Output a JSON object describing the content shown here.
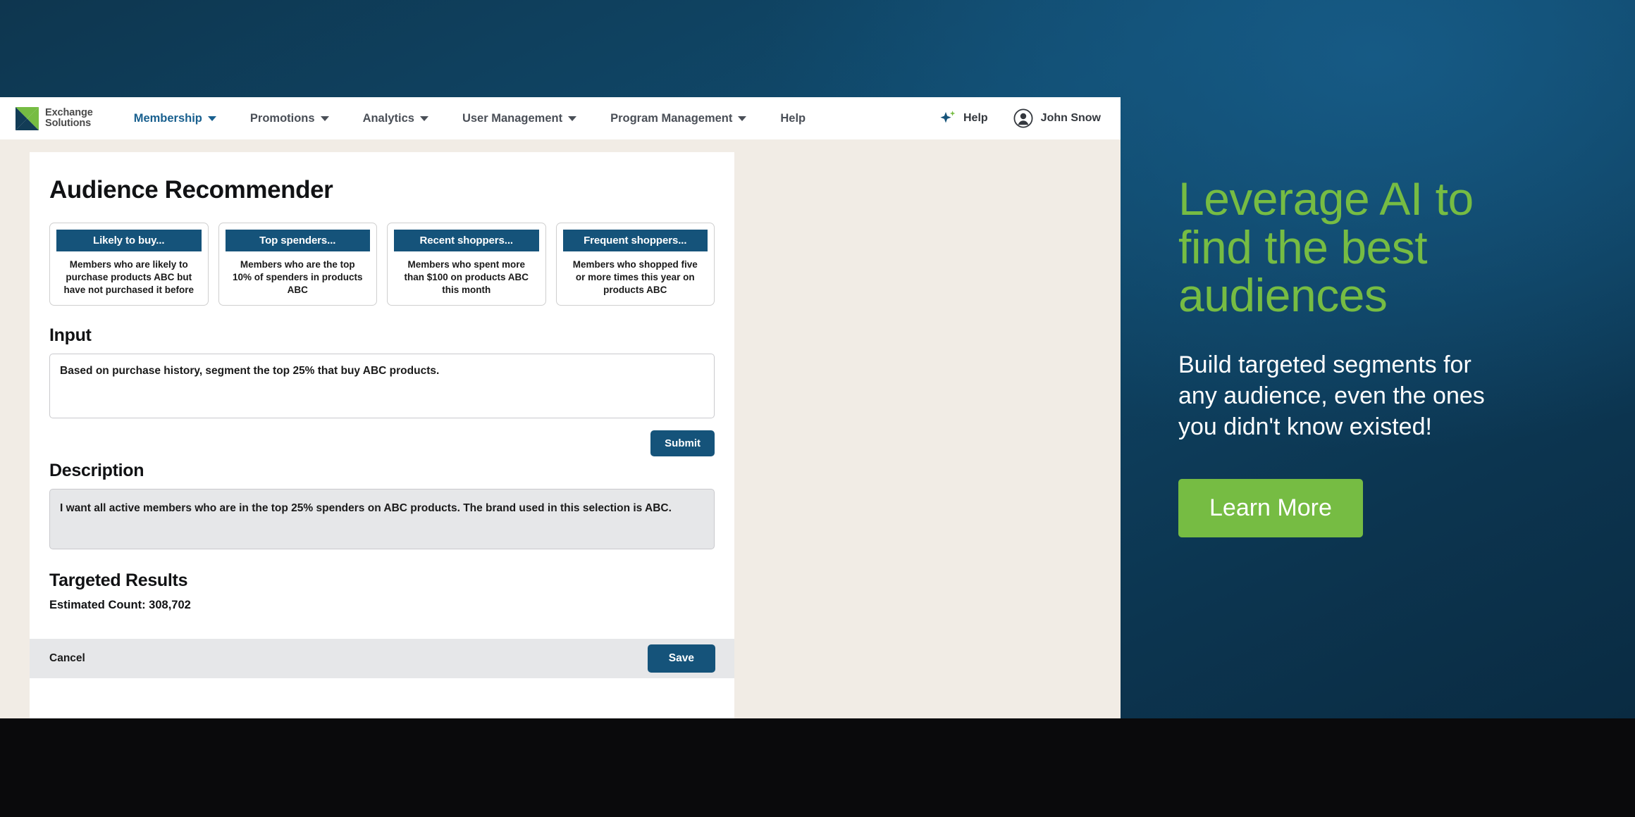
{
  "brand": {
    "logo_text": "Exchange\nSolutions",
    "logo_icon": "exchange-solutions-x-logo",
    "green": "#76bc43",
    "navy": "#15537a"
  },
  "navbar": {
    "items": [
      {
        "label": "Membership",
        "has_caret": true,
        "active": true
      },
      {
        "label": "Promotions",
        "has_caret": true,
        "active": false
      },
      {
        "label": "Analytics",
        "has_caret": true,
        "active": false
      },
      {
        "label": "User Management",
        "has_caret": true,
        "active": false
      },
      {
        "label": "Program Management",
        "has_caret": true,
        "active": false
      },
      {
        "label": "Help",
        "has_caret": false,
        "active": false
      }
    ],
    "help": {
      "label": "Help",
      "icon": "ai-sparkle-icon"
    },
    "user": {
      "name": "John Snow",
      "icon": "user-avatar-icon"
    }
  },
  "page": {
    "title": "Audience Recommender"
  },
  "suggestions": [
    {
      "title": "Likely to buy...",
      "description": "Members who are likely to purchase products ABC but have not purchased it before"
    },
    {
      "title": "Top spenders...",
      "description": "Members who are the top 10% of spenders in products ABC"
    },
    {
      "title": "Recent shoppers...",
      "description": "Members who spent more than $100 on products ABC this month"
    },
    {
      "title": "Frequent shoppers...",
      "description": "Members who shopped five or more times this year on products ABC"
    }
  ],
  "input_section": {
    "label": "Input",
    "value": "Based on purchase history, segment the top 25% that buy ABC products.",
    "placeholder": "",
    "submit_label": "Submit"
  },
  "description_section": {
    "label": "Description",
    "value": "I want all active members who are in the top 25% spenders on ABC products. The brand used in this selection is ABC."
  },
  "results_section": {
    "label": "Targeted Results",
    "count_label": "Estimated Count: 308,702"
  },
  "footer": {
    "cancel_label": "Cancel",
    "save_label": "Save"
  },
  "promo": {
    "heading": "Leverage AI to\nfind the best\naudiences",
    "subtext": "Build targeted segments for\nany audience, even the ones\nyou didn't know existed!",
    "cta_label": "Learn More"
  }
}
